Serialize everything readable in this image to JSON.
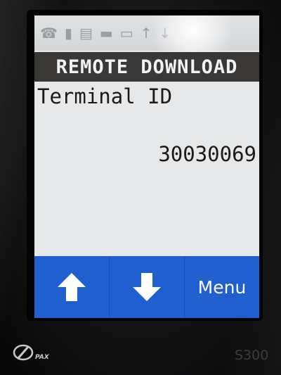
{
  "status_icons": [
    "signal-tower-icon",
    "signal-bars-icon",
    "printer-icon",
    "card-icon",
    "battery-icon",
    "up-arrow-icon"
  ],
  "title": "REMOTE DOWNLOAD",
  "field": {
    "label": "Terminal ID",
    "value": "30030069"
  },
  "softkeys": {
    "up_icon": "up-arrow-icon",
    "down_icon": "down-arrow-icon",
    "menu_label": "Menu"
  },
  "device": {
    "brand": "PAX",
    "model": "S300"
  },
  "colors": {
    "softkey_bar": "#1f5fd0",
    "title_bar": "#3a3836",
    "screen_background": "#e6e8ea"
  }
}
